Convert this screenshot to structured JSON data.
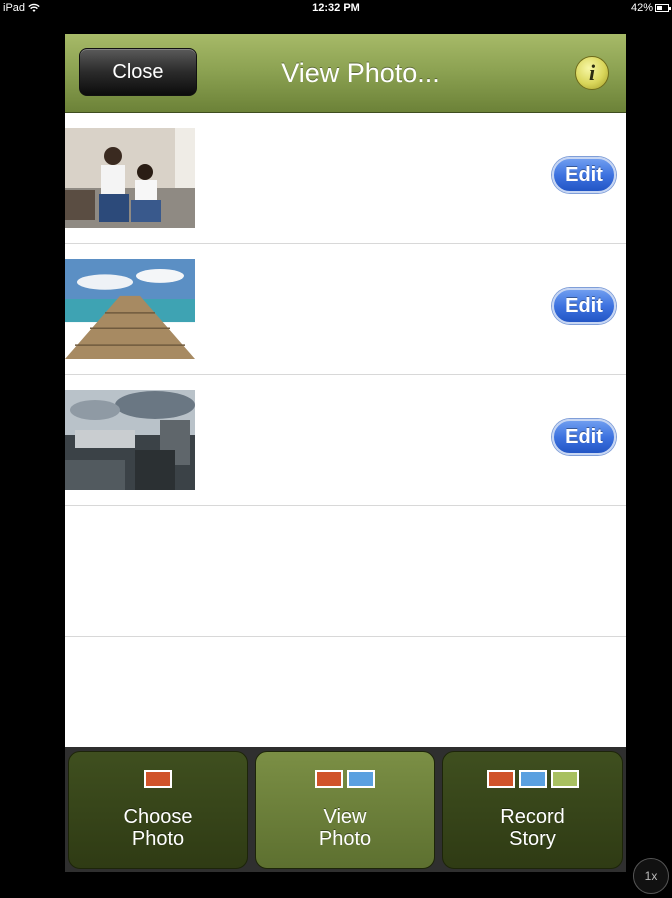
{
  "status_bar": {
    "device": "iPad",
    "time": "12:32 PM",
    "battery": "42%",
    "battery_level": 0.42
  },
  "navbar": {
    "close_label": "Close",
    "title": "View Photo...",
    "info_icon": "info-icon"
  },
  "rows": [
    {
      "thumbnail": "family-photo-thumbnail",
      "edit_label": "Edit"
    },
    {
      "thumbnail": "pier-photo-thumbnail",
      "edit_label": "Edit"
    },
    {
      "thumbnail": "harbor-photo-thumbnail",
      "edit_label": "Edit"
    },
    {},
    {}
  ],
  "tabs": [
    {
      "label_line1": "Choose",
      "label_line2": "Photo",
      "swatches": [
        "#d0532a"
      ],
      "active": false
    },
    {
      "label_line1": "View",
      "label_line2": "Photo",
      "swatches": [
        "#d0532a",
        "#5aa0e0"
      ],
      "active": true
    },
    {
      "label_line1": "Record",
      "label_line2": "Story",
      "swatches": [
        "#d0532a",
        "#5aa0e0",
        "#a8c060"
      ],
      "active": false
    }
  ],
  "colors": {
    "navbar": "#8da353",
    "edit_button": "#3e73e0",
    "tab_bar": "#2f3b14",
    "tab_active": "#6b7f3a"
  },
  "zoom_badge": "1x"
}
